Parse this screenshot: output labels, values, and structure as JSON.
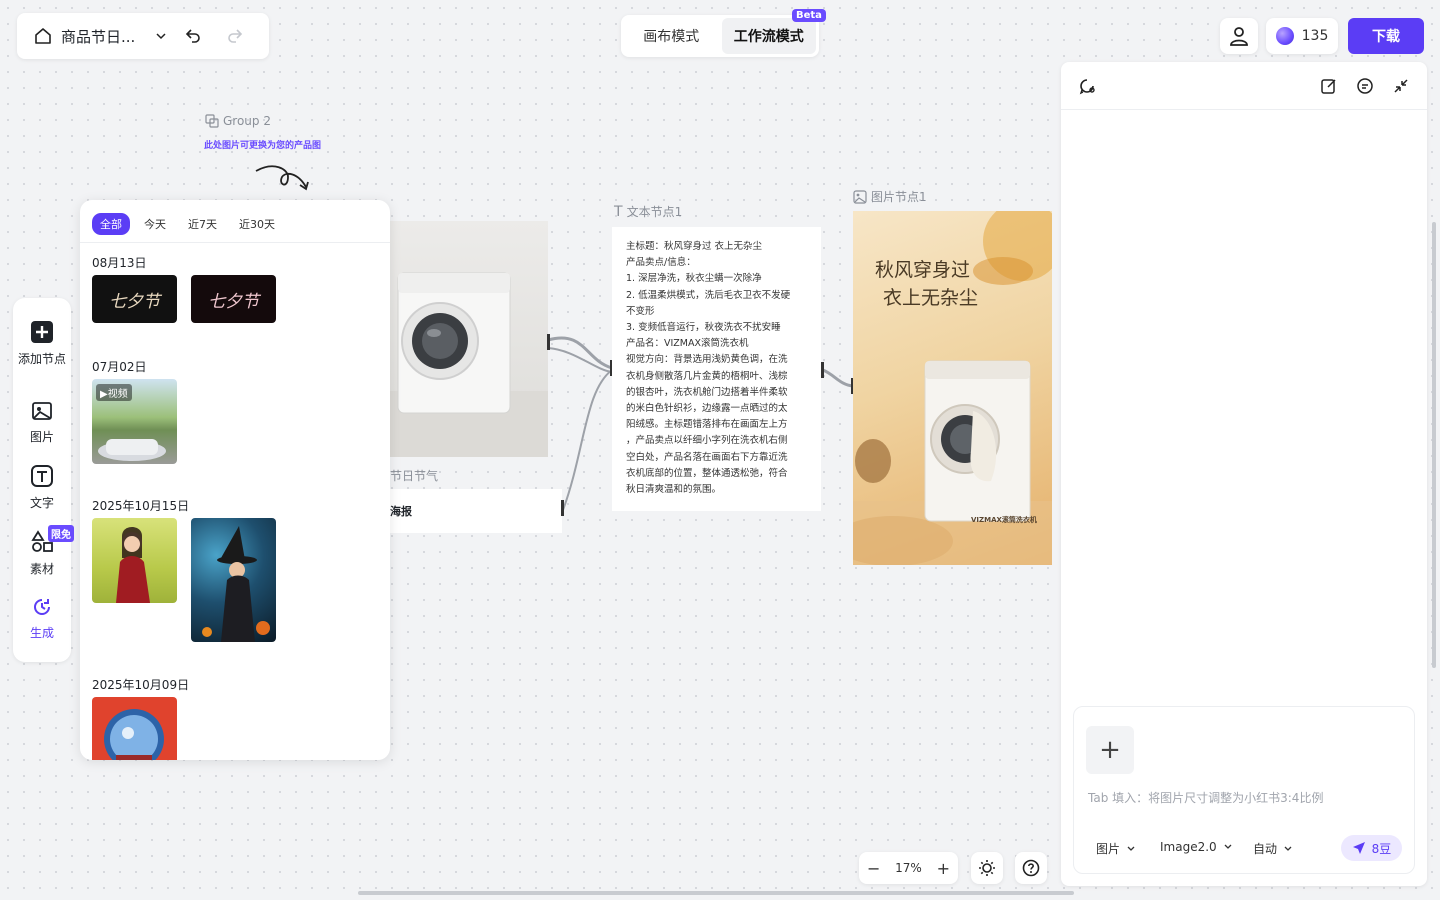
{
  "topbar": {
    "project_title": "商品节日...",
    "modes": [
      "画布模式",
      "工作流模式"
    ],
    "beta_badge": "Beta",
    "credits": "135",
    "download_label": "下载"
  },
  "canvas": {
    "group_label": "Group 2",
    "group_hint": "此处图片可更换为您的产品图",
    "text_node_label": "文本节点1",
    "image_node_label": "图片节点1",
    "partial_node_label": "节日节气",
    "partial_card_text": "海报",
    "text_node_lines": [
      "主标题：秋风穿身过 衣上无杂尘",
      "产品卖点/信息：",
      "1. 深层净洗，秋衣尘螨一次除净",
      "2. 低温柔烘模式，洗后毛衣卫衣不发硬",
      "不变形",
      "3. 变频低音运行，秋夜洗衣不扰安睡",
      "产品名：VIZMAX滚筒洗衣机",
      "视觉方向：背景选用浅奶黄色调，在洗",
      "衣机身侧散落几片金黄的梧桐叶、浅棕",
      "的银杏叶，洗衣机舱门边搭着半件柔软",
      "的米白色针织衫，边缘露一点晒过的太",
      "阳绒感。主标题错落排布在画面左上方",
      "，产品卖点以纤细小字列在洗衣机右侧",
      "空白处，产品名落在画面右下方靠近洗",
      "衣机底部的位置，整体通透松弛，符合",
      "秋日清爽温和的氛围。"
    ],
    "poster_title_1": "秋风穿身过",
    "poster_title_2": "衣上无杂尘",
    "poster_brand": "VIZMAX滚筒洗衣机"
  },
  "left_tools": [
    {
      "label": "添加节点"
    },
    {
      "label": "图片"
    },
    {
      "label": "文字"
    },
    {
      "label": "素材"
    },
    {
      "label": "生成"
    }
  ],
  "limited_badge": "限免",
  "history": {
    "filters": [
      "全部",
      "今天",
      "近7天",
      "近30天"
    ],
    "groups": [
      {
        "date": "08月13日",
        "thumb_texts": [
          "七夕节",
          "七夕节"
        ]
      },
      {
        "date": "07月02日",
        "video_badge": "视频"
      },
      {
        "date": "2025年10月15日"
      },
      {
        "date": "2025年10月09日"
      }
    ]
  },
  "composer": {
    "placeholder": "Tab 填入：将图片尺寸调整为小红书3:4比例",
    "type_select": "图片",
    "model_select": "Image2.0",
    "ratio_select": "自动",
    "send_cost": "8豆"
  },
  "zoom": {
    "level": "17%"
  },
  "colors": {
    "accent": "#5b3df5",
    "canvas_bg": "#f2f3f5",
    "badge": "#6a4cff"
  }
}
